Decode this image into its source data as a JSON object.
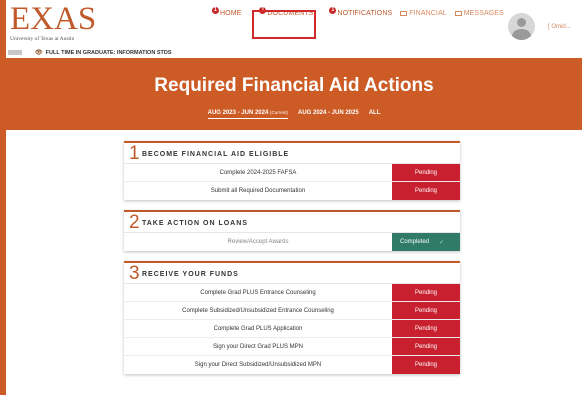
{
  "header": {
    "logo_text": "EXAS",
    "logo_subtext": "University of Texas at Austin",
    "student_status": "FULL TIME IN GRADUATE: INFORMATION STDS",
    "nav": [
      {
        "label": "HOME",
        "badge": "1"
      },
      {
        "label": "DOCUMENTS",
        "badge": "1"
      },
      {
        "label": "NOTIFICATIONS",
        "badge": "1"
      },
      {
        "label": "FINANCIAL"
      },
      {
        "label": "MESSAGES"
      }
    ],
    "user_name": "[ Omid...",
    "highlight_color": "#d12a2a"
  },
  "hero": {
    "title": "Required Financial Aid Actions",
    "tabs": [
      {
        "label": "AUG 2023 - JUN 2024",
        "suffix": "(Current)"
      },
      {
        "label": "AUG 2024 - JUN 2025"
      },
      {
        "label": "ALL"
      }
    ],
    "background_color": "#cc5b25"
  },
  "sections": [
    {
      "number": "1",
      "title": "BECOME FINANCIAL AID ELIGIBLE",
      "rows": [
        {
          "label": "Complete 2024-2025 FAFSA",
          "status": "Pending"
        },
        {
          "label": "Submit all Required Documentation",
          "status": "Pending"
        }
      ]
    },
    {
      "number": "2",
      "title": "TAKE ACTION ON LOANS",
      "rows": [
        {
          "label": "Review/Accept Awards",
          "status": "Completed"
        }
      ]
    },
    {
      "number": "3",
      "title": "RECEIVE YOUR FUNDS",
      "rows": [
        {
          "label": "Complete Grad PLUS Entrance Counseling",
          "status": "Pending"
        },
        {
          "label": "Complete Subsidized/Unsubsidized Entrance Counseling",
          "status": "Pending"
        },
        {
          "label": "Complete Grad PLUS Application",
          "status": "Pending"
        },
        {
          "label": "Sign your Direct Grad PLUS MPN",
          "status": "Pending"
        },
        {
          "label": "Sign your Direct Subsidized/Unsubsidized MPN",
          "status": "Pending"
        }
      ]
    }
  ],
  "colors": {
    "pending": "#c8202f",
    "completed": "#2f7a68",
    "accent": "#c05a2b"
  }
}
